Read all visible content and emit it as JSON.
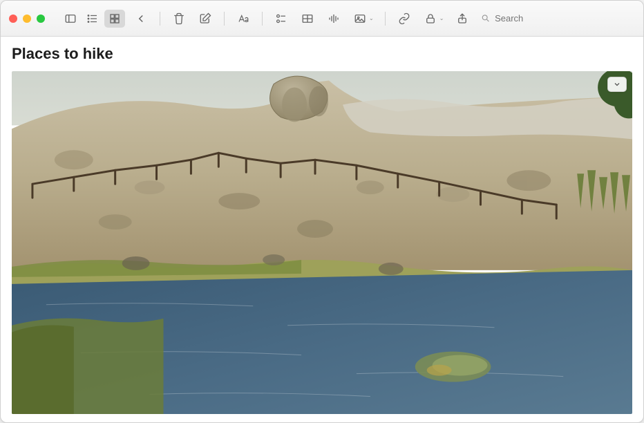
{
  "window": {
    "traffic_lights": {
      "close": "close-window",
      "minimize": "minimize-window",
      "maximize": "fullscreen-window"
    }
  },
  "toolbar": {
    "sidebar_toggle": "Toggle Sidebar",
    "list_view": "List View",
    "gallery_view": "Gallery View",
    "back": "Back",
    "delete": "Delete",
    "new_note": "New Note",
    "format": "Format",
    "checklist": "Checklist",
    "table": "Table",
    "audio": "Audio",
    "media": "Media",
    "link": "Link",
    "lock": "Lock",
    "share": "Share"
  },
  "search": {
    "placeholder": "Search"
  },
  "note": {
    "title": "Places to hike",
    "image_alt": "Landscape photo: rocky arid hillside with a zig-zag wooden fence, dry grass, and a calm river with green grassy banks in the foreground",
    "image_menu": "Image options"
  }
}
